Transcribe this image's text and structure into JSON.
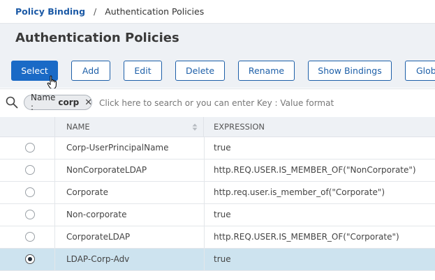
{
  "breadcrumb": {
    "parent": "Policy Binding",
    "separator": "/",
    "current": "Authentication Policies"
  },
  "page": {
    "title": "Authentication Policies"
  },
  "toolbar": {
    "select": "Select",
    "add": "Add",
    "edit": "Edit",
    "delete": "Delete",
    "rename": "Rename",
    "show_bindings": "Show Bindings",
    "global": "Glob"
  },
  "search": {
    "chip_key": "Name :",
    "chip_value": "corp",
    "chip_remove": "✕",
    "placeholder": "Click here to search or you can enter Key : Value format"
  },
  "table": {
    "columns": {
      "name": "NAME",
      "expression": "EXPRESSION"
    },
    "rows": [
      {
        "name": "Corp-UserPrincipalName",
        "expression": "true"
      },
      {
        "name": "NonCorporateLDAP",
        "expression": "http.REQ.USER.IS_MEMBER_OF(\"NonCorporate\")"
      },
      {
        "name": "Corporate",
        "expression": "http.req.user.is_member_of(\"Corporate\")"
      },
      {
        "name": "Non-corporate",
        "expression": "true"
      },
      {
        "name": "CorporateLDAP",
        "expression": "http.REQ.USER.IS_MEMBER_OF(\"Corporate\")"
      },
      {
        "name": "LDAP-Corp-Adv",
        "expression": "true"
      }
    ],
    "selected_index": 5
  },
  "colors": {
    "accent": "#1a6ac6",
    "link": "#1c5aa6",
    "selected_row": "#cde3ef",
    "header_bg": "#eef1f5"
  },
  "icons": {
    "search": "search-icon",
    "sort": "sort-icon",
    "cursor": "hand-cursor-icon",
    "remove": "close-icon"
  }
}
